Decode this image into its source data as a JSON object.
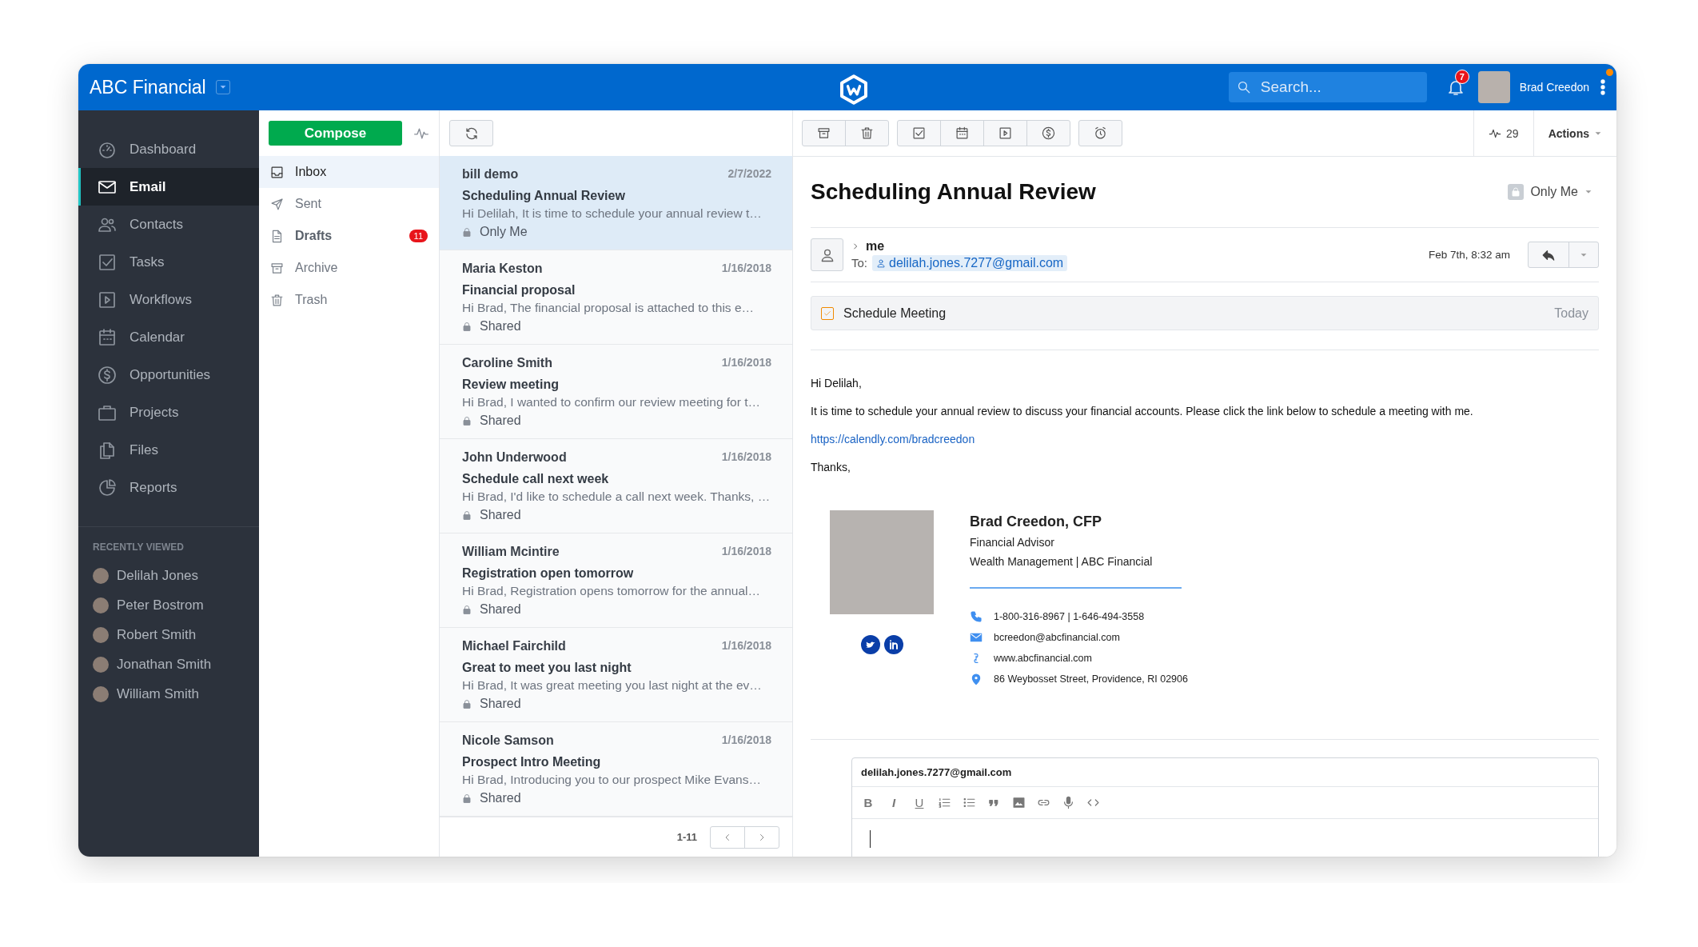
{
  "header": {
    "brand": "ABC Financial",
    "search": {
      "placeholder": "Search..."
    },
    "notifications": "7",
    "user": "Brad Creedon"
  },
  "nav": {
    "items": [
      {
        "label": "Dashboard",
        "selected": false
      },
      {
        "label": "Email",
        "selected": true
      },
      {
        "label": "Contacts",
        "selected": false
      },
      {
        "label": "Tasks",
        "selected": false
      },
      {
        "label": "Workflows",
        "selected": false
      },
      {
        "label": "Calendar",
        "selected": false
      },
      {
        "label": "Opportunities",
        "selected": false
      },
      {
        "label": "Projects",
        "selected": false
      },
      {
        "label": "Files",
        "selected": false
      },
      {
        "label": "Reports",
        "selected": false
      }
    ],
    "recent_title": "RECENTLY VIEWED",
    "recent": [
      "Delilah Jones",
      "Peter Bostrom",
      "Robert Smith",
      "Jonathan Smith",
      "William Smith"
    ]
  },
  "folders": {
    "compose": "Compose",
    "items": [
      {
        "label": "Inbox",
        "selected": true,
        "unread": false
      },
      {
        "label": "Sent",
        "selected": false,
        "unread": false
      },
      {
        "label": "Drafts",
        "selected": false,
        "unread": true,
        "badge": "11"
      },
      {
        "label": "Archive",
        "selected": false,
        "unread": false
      },
      {
        "label": "Trash",
        "selected": false,
        "unread": false
      }
    ]
  },
  "messages": [
    {
      "sender": "bill demo",
      "date": "2/7/2022",
      "subject": "Scheduling Annual Review",
      "preview": "Hi Delilah, It is time to schedule your annual review t…",
      "visibility": "Only Me",
      "selected": true
    },
    {
      "sender": "Maria Keston",
      "date": "1/16/2018",
      "subject": "Financial proposal",
      "preview": "Hi Brad, The financial proposal is attached to this e…",
      "visibility": "Shared",
      "selected": false
    },
    {
      "sender": "Caroline Smith",
      "date": "1/16/2018",
      "subject": "Review meeting",
      "preview": "Hi Brad, I wanted to confirm our review meeting for t…",
      "visibility": "Shared",
      "selected": false
    },
    {
      "sender": "John Underwood",
      "date": "1/16/2018",
      "subject": "Schedule call next week",
      "preview": "Hi Brad, I'd like to schedule a call next week. Thanks, …",
      "visibility": "Shared",
      "selected": false
    },
    {
      "sender": "William Mcintire",
      "date": "1/16/2018",
      "subject": "Registration open tomorrow",
      "preview": "Hi Brad, Registration opens tomorrow for the annual…",
      "visibility": "Shared",
      "selected": false
    },
    {
      "sender": "Michael Fairchild",
      "date": "1/16/2018",
      "subject": "Great to meet you last night",
      "preview": "Hi Brad, It was great meeting you last night at the ev…",
      "visibility": "Shared",
      "selected": false
    },
    {
      "sender": "Nicole Samson",
      "date": "1/16/2018",
      "subject": "Prospect Intro Meeting",
      "preview": "Hi Brad, Introducing you to our prospect Mike Evans…",
      "visibility": "Shared",
      "selected": false
    }
  ],
  "pagination": "1-11",
  "pane": {
    "activity": "29",
    "actions": "Actions"
  },
  "email": {
    "title": "Scheduling Annual Review",
    "privacy": "Only Me",
    "from": "me",
    "to_label": "To:",
    "to": "delilah.jones.7277@gmail.com",
    "time": "Feb 7th, 8:32 am",
    "task": {
      "label": "Schedule Meeting",
      "checked": true,
      "due": "Today"
    },
    "body": [
      {
        "kind": "text",
        "text": "Hi Delilah,"
      },
      {
        "kind": "text",
        "text": "It is time to schedule your annual review to discuss your financial accounts. Please click the link below to schedule a meeting with me."
      },
      {
        "kind": "link",
        "text": "https://calendly.com/bradcreedon"
      },
      {
        "kind": "text",
        "text": "Thanks,"
      }
    ],
    "signature": {
      "name": "Brad Creedon, CFP",
      "title": "Financial Advisor",
      "company": "Wealth Management | ABC Financial",
      "contacts": [
        {
          "kind": "phone",
          "text": "1-800-316-8967 | 1-646-494-3558"
        },
        {
          "kind": "email",
          "text": "bcreedon@abcfinancial.com"
        },
        {
          "kind": "web",
          "text": "www.abcfinancial.com"
        },
        {
          "kind": "address",
          "text": "86 Weybosset Street, Providence, RI 02906"
        }
      ]
    }
  },
  "reply": {
    "to": "delilah.jones.7277@gmail.com",
    "format": [
      {
        "kind": "bold",
        "label": "B"
      },
      {
        "kind": "italic",
        "label": "I"
      },
      {
        "kind": "underline",
        "label": "U"
      },
      {
        "kind": "ordered-list"
      },
      {
        "kind": "bullet-list"
      },
      {
        "kind": "quote"
      },
      {
        "kind": "image"
      },
      {
        "kind": "link"
      },
      {
        "kind": "microphone"
      },
      {
        "kind": "code"
      }
    ]
  }
}
